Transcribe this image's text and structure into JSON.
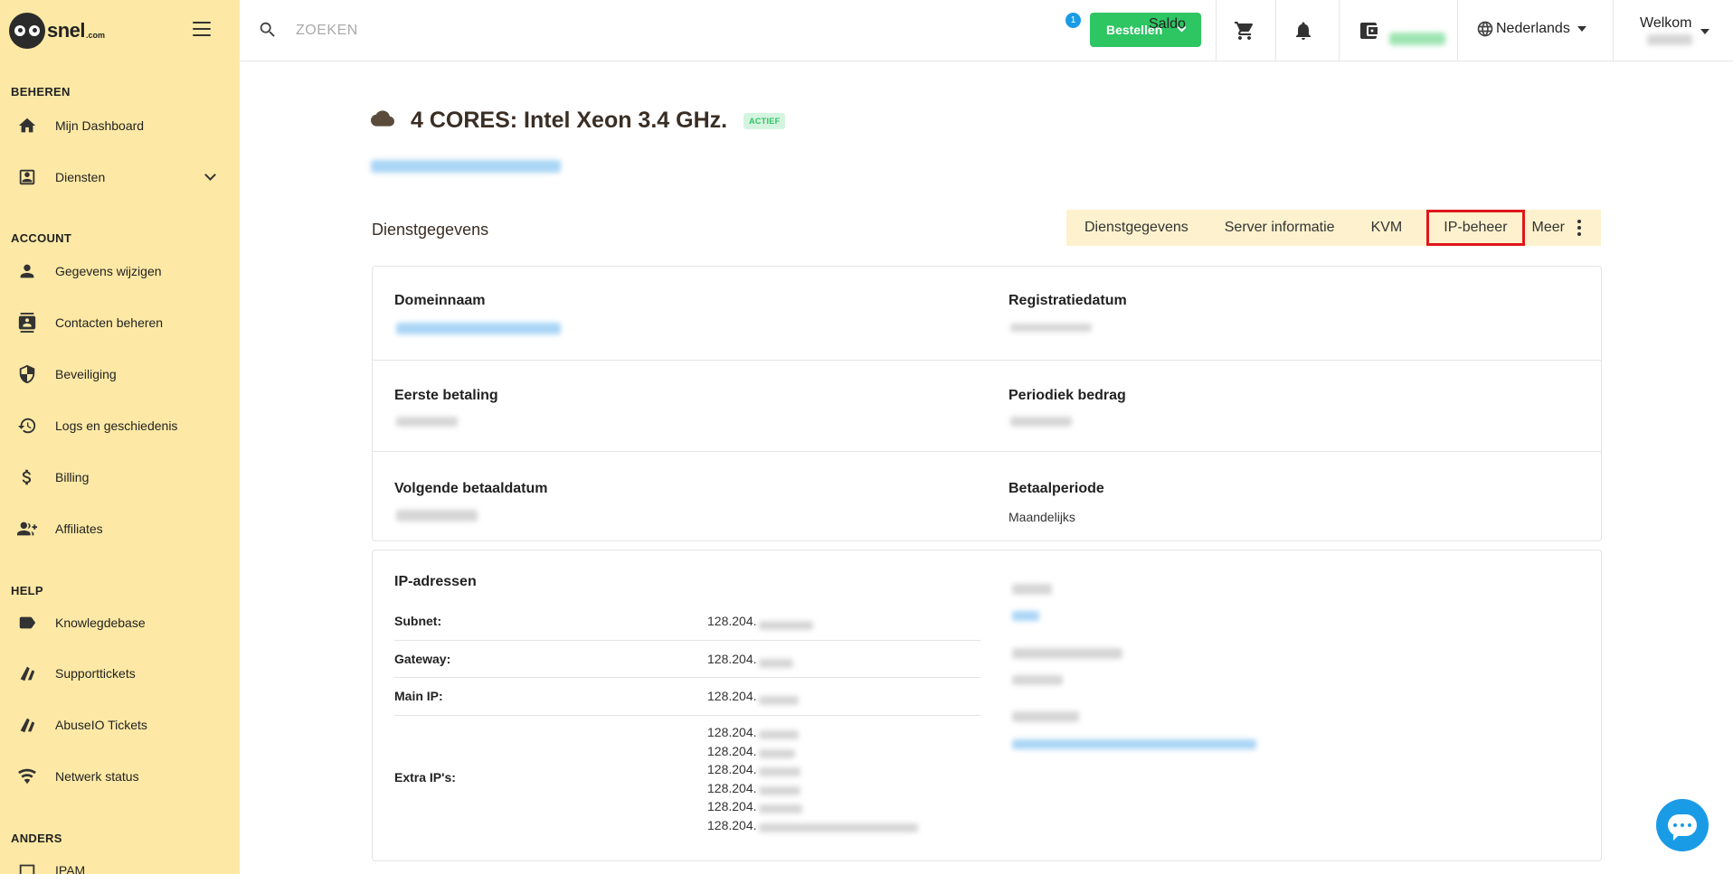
{
  "brand": {
    "name": "snel",
    "tld": ".com"
  },
  "sidebar": {
    "sections": [
      {
        "title": "BEHEREN"
      },
      {
        "title": "ACCOUNT"
      },
      {
        "title": "HELP"
      },
      {
        "title": "ANDERS"
      }
    ],
    "items": [
      {
        "label": "Mijn Dashboard",
        "icon": "home-icon"
      },
      {
        "label": "Diensten",
        "icon": "services-icon"
      },
      {
        "label": "Gegevens wijzigen",
        "icon": "person-icon"
      },
      {
        "label": "Contacten beheren",
        "icon": "contacts-icon"
      },
      {
        "label": "Beveiliging",
        "icon": "shield-icon"
      },
      {
        "label": "Logs en geschiedenis",
        "icon": "history-icon"
      },
      {
        "label": "Billing",
        "icon": "dollar-icon"
      },
      {
        "label": "Affiliates",
        "icon": "group-add-icon"
      },
      {
        "label": "Knowlegdebase",
        "icon": "label-icon"
      },
      {
        "label": "Supporttickets",
        "icon": "tickets-icon"
      },
      {
        "label": "AbuseIO Tickets",
        "icon": "tickets-icon"
      },
      {
        "label": "Netwerk status",
        "icon": "network-icon"
      },
      {
        "label": "IPAM",
        "icon": "ipam-icon"
      }
    ]
  },
  "topbar": {
    "search_placeholder": "ZOEKEN",
    "order_label": "Bestellen",
    "notification_count": "1",
    "saldo_label": "Saldo",
    "language": "Nederlands",
    "welcome": "Welkom"
  },
  "page": {
    "title": "4 CORES: Intel Xeon 3.4 GHz.",
    "status": "ACTIEF",
    "section_title": "Dienstgegevens"
  },
  "tabs": [
    {
      "label": "Dienstgegevens"
    },
    {
      "label": "Server informatie"
    },
    {
      "label": "KVM"
    },
    {
      "label": "IP-beheer",
      "active": true
    },
    {
      "label": "Meer"
    }
  ],
  "details": {
    "domain_label": "Domeinnaam",
    "registration_label": "Registratiedatum",
    "first_payment_label": "Eerste betaling",
    "periodic_amount_label": "Periodiek bedrag",
    "next_due_label": "Volgende betaaldatum",
    "billing_period_label": "Betaalperiode",
    "billing_period_value": "Maandelijks"
  },
  "ip": {
    "title": "IP-adressen",
    "subnet_label": "Subnet:",
    "gateway_label": "Gateway:",
    "main_label": "Main IP:",
    "extra_label": "Extra IP's:",
    "prefix": "128.204.",
    "extra_count": 6
  },
  "colors": {
    "sidebar_bg": "#fde9a5",
    "accent_green": "#2ec563",
    "tab_bg": "#fdf2cd",
    "highlight_red": "#e0161a",
    "chat_blue": "#1a9be6"
  }
}
